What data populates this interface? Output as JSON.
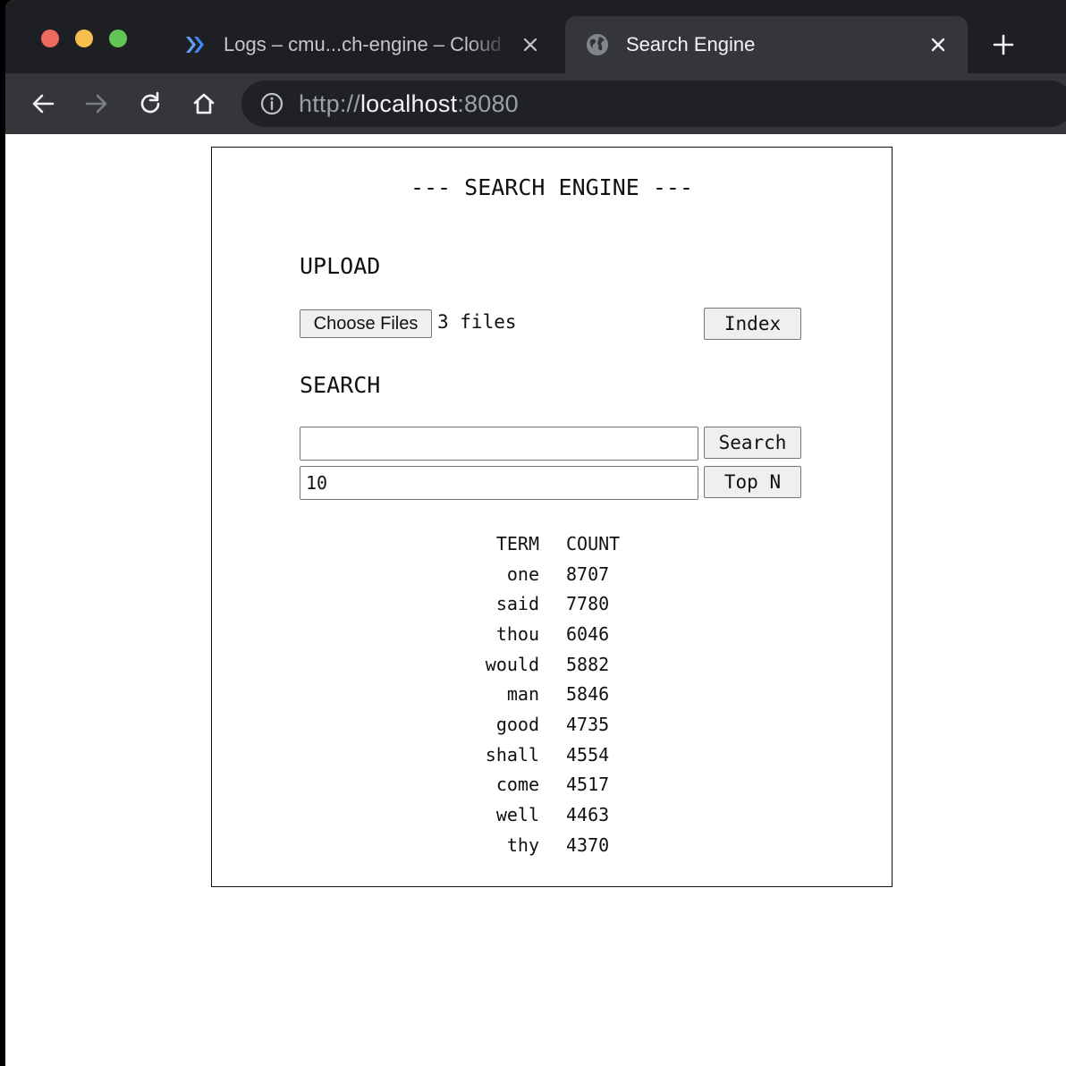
{
  "browser": {
    "tabs": [
      {
        "title": "Logs – cmu...ch-engine – Cloud",
        "icon": "cloud-logging-icon",
        "active": false
      },
      {
        "title": "Search Engine",
        "icon": "globe-icon",
        "active": true
      }
    ],
    "address": {
      "scheme": "http://",
      "host": "localhost",
      "port": ":8080"
    }
  },
  "app": {
    "title": "--- SEARCH ENGINE ---",
    "upload": {
      "heading": "UPLOAD",
      "choose_label": "Choose Files",
      "file_status": "3 files",
      "index_label": "Index"
    },
    "search": {
      "heading": "SEARCH",
      "query_value": "",
      "search_label": "Search",
      "topn_value": "10",
      "topn_label": "Top N"
    },
    "results": {
      "headers": {
        "term": "TERM",
        "count": "COUNT"
      },
      "rows": [
        {
          "term": "one",
          "count": "8707"
        },
        {
          "term": "said",
          "count": "7780"
        },
        {
          "term": "thou",
          "count": "6046"
        },
        {
          "term": "would",
          "count": "5882"
        },
        {
          "term": "man",
          "count": "5846"
        },
        {
          "term": "good",
          "count": "4735"
        },
        {
          "term": "shall",
          "count": "4554"
        },
        {
          "term": "come",
          "count": "4517"
        },
        {
          "term": "well",
          "count": "4463"
        },
        {
          "term": "thy",
          "count": "4370"
        }
      ]
    }
  },
  "colors": {
    "titlebar": "#1e1f22",
    "toolbar": "#35363a",
    "omnibox": "#202124",
    "traffic_red": "#ee6a5f",
    "traffic_yellow": "#f5be4f",
    "traffic_green": "#61c454",
    "cloud_logo": "#669df6"
  }
}
